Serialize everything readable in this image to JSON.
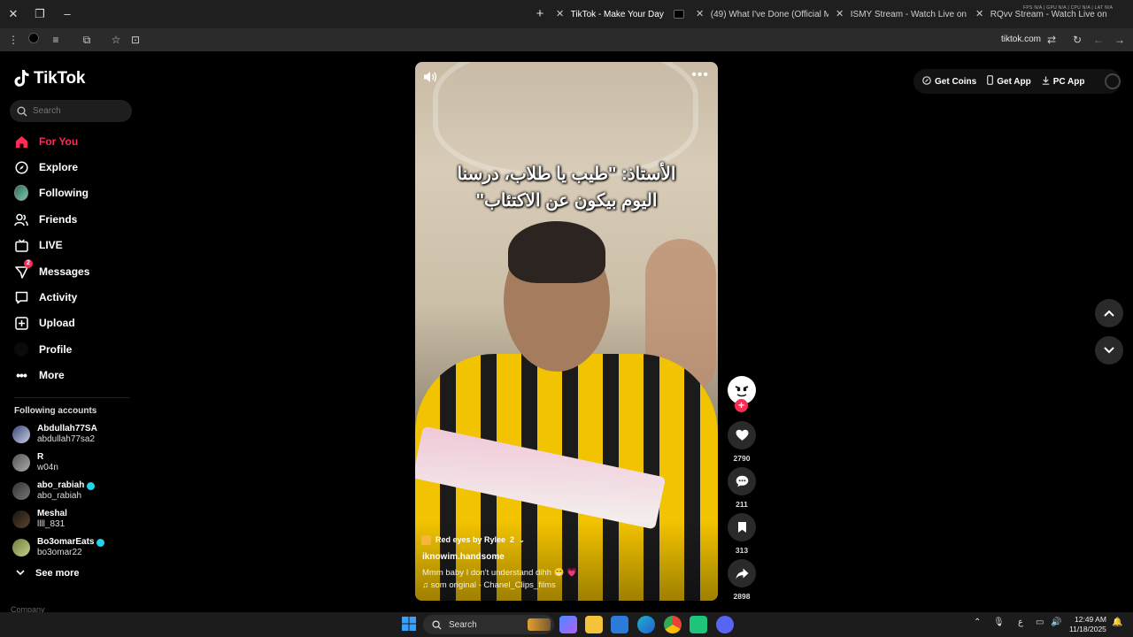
{
  "browser": {
    "tabs": [
      {
        "title": "TikTok - Make Your Day",
        "active": true
      },
      {
        "title": "(49) What I've Done (Official M",
        "active": false
      },
      {
        "title": "ISMY Stream - Watch Live on K",
        "active": false
      },
      {
        "title": "RQvv Stream - Watch Live on K",
        "active": false
      }
    ],
    "url": "tiktok.com",
    "stats": "FPS N/A  |  GPU N/A  |  CPU N/A  |  LAT N/A"
  },
  "sidebar": {
    "logo": "TikTok",
    "search_placeholder": "Search",
    "nav": [
      {
        "label": "For You",
        "icon": "home-icon",
        "active": true
      },
      {
        "label": "Explore",
        "icon": "compass-icon"
      },
      {
        "label": "Following",
        "icon": "following-avatar-icon"
      },
      {
        "label": "Friends",
        "icon": "friends-icon"
      },
      {
        "label": "LIVE",
        "icon": "live-tv-icon"
      },
      {
        "label": "Messages",
        "icon": "messages-icon",
        "badge": "2"
      },
      {
        "label": "Activity",
        "icon": "activity-icon"
      },
      {
        "label": "Upload",
        "icon": "upload-icon"
      },
      {
        "label": "Profile",
        "icon": "profile-avatar-icon"
      },
      {
        "label": "More",
        "icon": "more-dots-icon"
      }
    ],
    "following_title": "Following accounts",
    "accounts": [
      {
        "name": "Abdullah77SA",
        "handle": "abdullah77sa2",
        "verified": false
      },
      {
        "name": "R",
        "handle": "w04n",
        "verified": false
      },
      {
        "name": "abo_rabiah",
        "handle": "abo_rabiah",
        "verified": true
      },
      {
        "name": "Meshal",
        "handle": "llll_831",
        "verified": false
      },
      {
        "name": "Bo3omarEats",
        "handle": "bo3omar22",
        "verified": true
      }
    ],
    "see_more": "See more",
    "company": "Company"
  },
  "video": {
    "caption_line1": "الأستاذ: \"طيب يا طلاب، درسنا",
    "caption_line2": "اليوم بيكون عن الاكتئاب\"",
    "music_pill": "Red eyes by Rylee",
    "music_count": "2",
    "author": "iknowim.handsome",
    "description": "Mmm baby I don't understand dihh 😁 💗",
    "sound": "som original - Chanel_Clips_films"
  },
  "actions": {
    "likes": "2790",
    "comments": "211",
    "saves": "313",
    "shares": "2898"
  },
  "topright": {
    "get_coins": "Get Coins",
    "get_app": "Get App",
    "pc_app": "PC App"
  },
  "taskbar": {
    "search": "Search",
    "lang": "ع",
    "time": "12:49 AM",
    "date": "11/18/2025"
  },
  "colors": {
    "accent": "#fe2c55",
    "verified": "#20d5ec"
  }
}
